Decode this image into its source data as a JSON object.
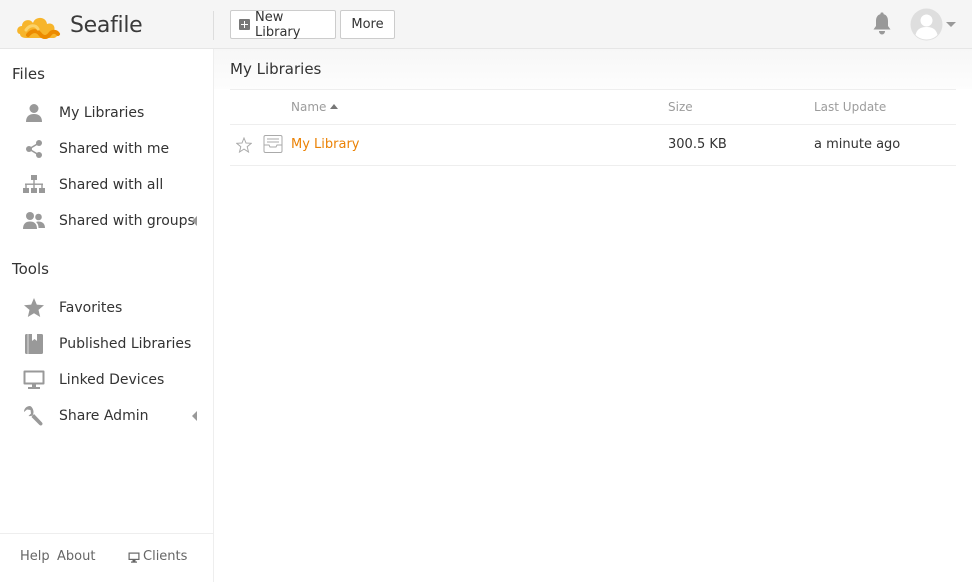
{
  "header": {
    "logo_text": "Seafile",
    "new_library_label": "New Library",
    "more_label": "More"
  },
  "sidebar": {
    "files_title": "Files",
    "files_items": [
      {
        "label": "My Libraries",
        "icon": "user-icon"
      },
      {
        "label": "Shared with me",
        "icon": "share-icon"
      },
      {
        "label": "Shared with all",
        "icon": "org-chart-icon"
      },
      {
        "label": "Shared with groups",
        "icon": "group-icon",
        "expandable": true
      }
    ],
    "tools_title": "Tools",
    "tools_items": [
      {
        "label": "Favorites",
        "icon": "star-icon"
      },
      {
        "label": "Published Libraries",
        "icon": "book-icon"
      },
      {
        "label": "Linked Devices",
        "icon": "monitor-icon"
      },
      {
        "label": "Share Admin",
        "icon": "wrench-icon",
        "expandable": true
      }
    ],
    "footer": {
      "help": "Help",
      "about": "About",
      "clients": "Clients"
    }
  },
  "main": {
    "title": "My Libraries",
    "columns": {
      "name": "Name",
      "size": "Size",
      "last_update": "Last Update"
    },
    "rows": [
      {
        "name": "My Library",
        "size": "300.5 KB",
        "last_update": "a minute ago",
        "starred": false
      }
    ]
  },
  "colors": {
    "accent": "#eb8205",
    "icon_gray": "#999999"
  }
}
